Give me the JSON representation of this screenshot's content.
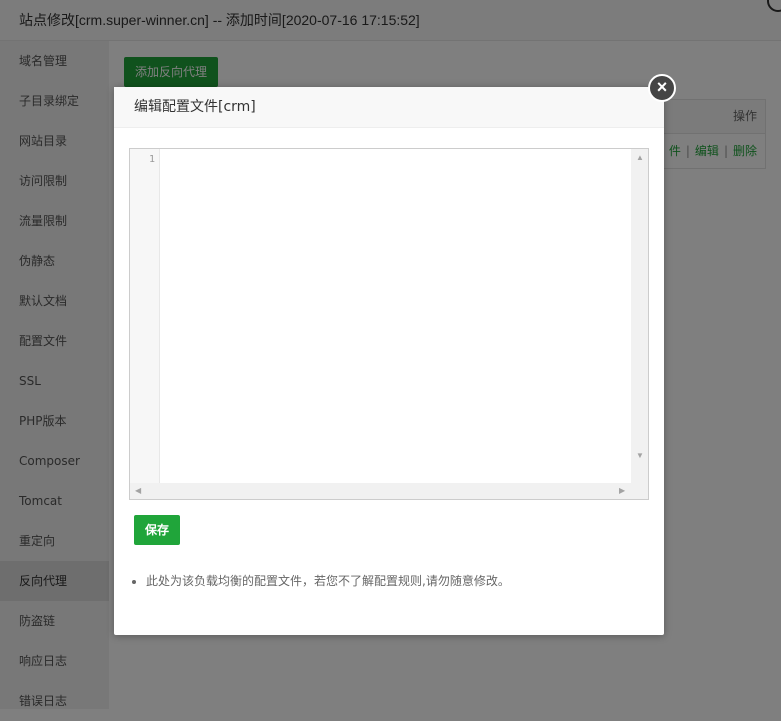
{
  "window": {
    "title": "站点修改[crm.super-winner.cn] -- 添加时间[2020-07-16 17:15:52]"
  },
  "sidebar": {
    "items": [
      {
        "label": "域名管理"
      },
      {
        "label": "子目录绑定"
      },
      {
        "label": "网站目录"
      },
      {
        "label": "访问限制"
      },
      {
        "label": "流量限制"
      },
      {
        "label": "伪静态"
      },
      {
        "label": "默认文档"
      },
      {
        "label": "配置文件"
      },
      {
        "label": "SSL"
      },
      {
        "label": "PHP版本"
      },
      {
        "label": "Composer"
      },
      {
        "label": "Tomcat"
      },
      {
        "label": "重定向"
      },
      {
        "label": "反向代理",
        "active": true
      },
      {
        "label": "防盗链"
      },
      {
        "label": "响应日志"
      },
      {
        "label": "错误日志"
      }
    ]
  },
  "main": {
    "add_button": "添加反向代理",
    "table": {
      "header_action": "操作",
      "row_actions": {
        "file_fragment": "件",
        "edit": "编辑",
        "delete": "删除"
      }
    }
  },
  "modal": {
    "title": "编辑配置文件[crm]",
    "close_icon": "×",
    "editor": {
      "line_numbers": [
        "1"
      ],
      "content": ""
    },
    "save_button": "保存",
    "help_items": [
      "此处为该负载均衡的配置文件，若您不了解配置规则,请勿随意修改。"
    ]
  },
  "colors": {
    "accent_green": "#20a53a",
    "overlay": "rgba(0,0,0,0.5)"
  }
}
